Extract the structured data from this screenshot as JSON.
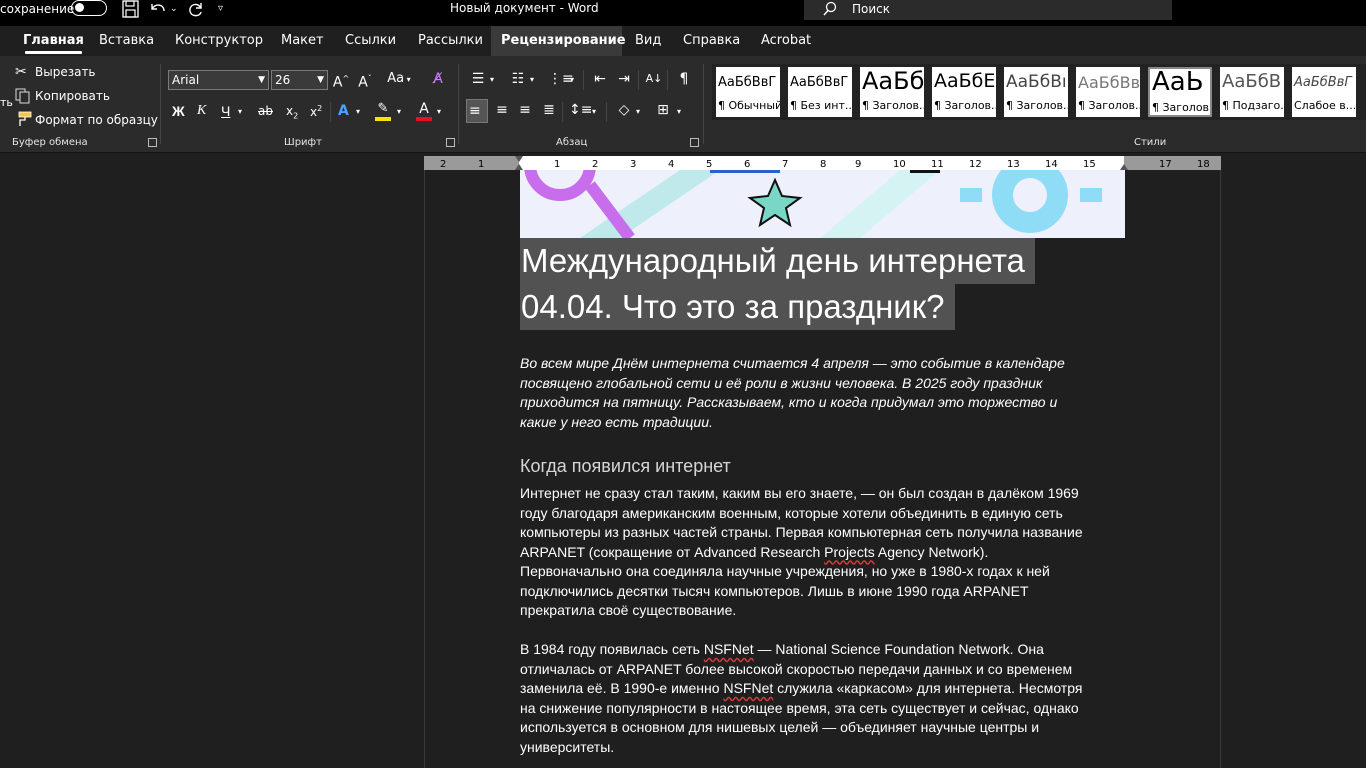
{
  "titlebar": {
    "autosave_label": "сохранение",
    "doc_title": "Новый документ  -  Word",
    "search_placeholder": "Поиск"
  },
  "tabs": [
    {
      "label": "Главная"
    },
    {
      "label": "Вставка"
    },
    {
      "label": "Конструктор"
    },
    {
      "label": "Макет"
    },
    {
      "label": "Ссылки"
    },
    {
      "label": "Рассылки"
    },
    {
      "label": "Рецензирование"
    },
    {
      "label": "Вид"
    },
    {
      "label": "Справка"
    },
    {
      "label": "Acrobat"
    }
  ],
  "clipboard": {
    "paste_fragment": "ть",
    "cut": "Вырезать",
    "copy": "Копировать",
    "format_painter": "Формат по образцу",
    "group_label": "Буфер обмена"
  },
  "font": {
    "family": "Arial",
    "size": "26",
    "group_label": "Шрифт",
    "case_label": "Аа"
  },
  "paragraph": {
    "group_label": "Абзац"
  },
  "styles": {
    "group_label": "Стили",
    "items": [
      {
        "sample": "АаБбВвГ",
        "name": "¶ Обычный"
      },
      {
        "sample": "АаБбВвГ",
        "name": "¶ Без инт..."
      },
      {
        "sample": "АаБб",
        "name": "¶ Заголов..."
      },
      {
        "sample": "АаБбЕ",
        "name": "¶ Заголов..."
      },
      {
        "sample": "АаБбВı",
        "name": "¶ Заголов..."
      },
      {
        "sample": "АаБбВві",
        "name": "¶ Заголов..."
      },
      {
        "sample": "АаЬ",
        "name": "¶ Заголов..."
      },
      {
        "sample": "АаБбВ",
        "name": "¶ Подзаго..."
      },
      {
        "sample": "АаБбВвГ",
        "name": "Слабое в..."
      }
    ]
  },
  "ruler": {
    "ticks": [
      "2",
      "1",
      "1",
      "2",
      "3",
      "4",
      "5",
      "6",
      "7",
      "8",
      "9",
      "10",
      "11",
      "12",
      "13",
      "14",
      "15",
      "17",
      "18"
    ]
  },
  "document": {
    "title_line1": "Международный день интернета",
    "title_line2": "04.04. Что это за праздник?",
    "lead": [
      "Во всем мире Днём интернета считается 4 апреля — это событие в календаре",
      "посвящено глобальной сети и её роли в жизни человека. В 2025 году праздник",
      "приходится на пятницу. Рассказываем, кто и когда придумал это торжество и",
      "какие у него есть традиции."
    ],
    "subheading": "Когда появился интернет",
    "para1": {
      "l1": "Интернет не сразу стал таким, каким вы его знаете, — он был создан в далёком 1969",
      "l2": "году благодаря американским военным, которые хотели объединить в единую сеть",
      "l3": "компьютеры из разных частей страны. Первая компьютерная сеть получила название",
      "l4_a": "ARPANET (сокращение от Advanced Research ",
      "l4_b": "Projects",
      "l4_c": " Agency Network).",
      "l5": "Первоначально она соединяла научные учреждения, но уже в 1980-х годах к ней",
      "l6": "подключились десятки тысяч компьютеров. Лишь в июне 1990 года ARPANET",
      "l7": "прекратила своё существование."
    },
    "para2": {
      "l1_a": "В 1984 году появилась сеть ",
      "l1_b": "NSFNet",
      "l1_c": " — National Science Foundation Network. Она",
      "l2": "отличалась от ARPANET более высокой скоростью передачи данных и со временем",
      "l3_a": "заменила её. В 1990-е именно ",
      "l3_b": "NSFNet",
      "l3_c": " служила «каркасом» для интернета. Несмотря",
      "l4": "на снижение популярности в настоящее время, эта сеть существует и сейчас, однако",
      "l5": "используется в основном для нишевых целей — объединяет научные центры и",
      "l6": "университеты."
    }
  }
}
